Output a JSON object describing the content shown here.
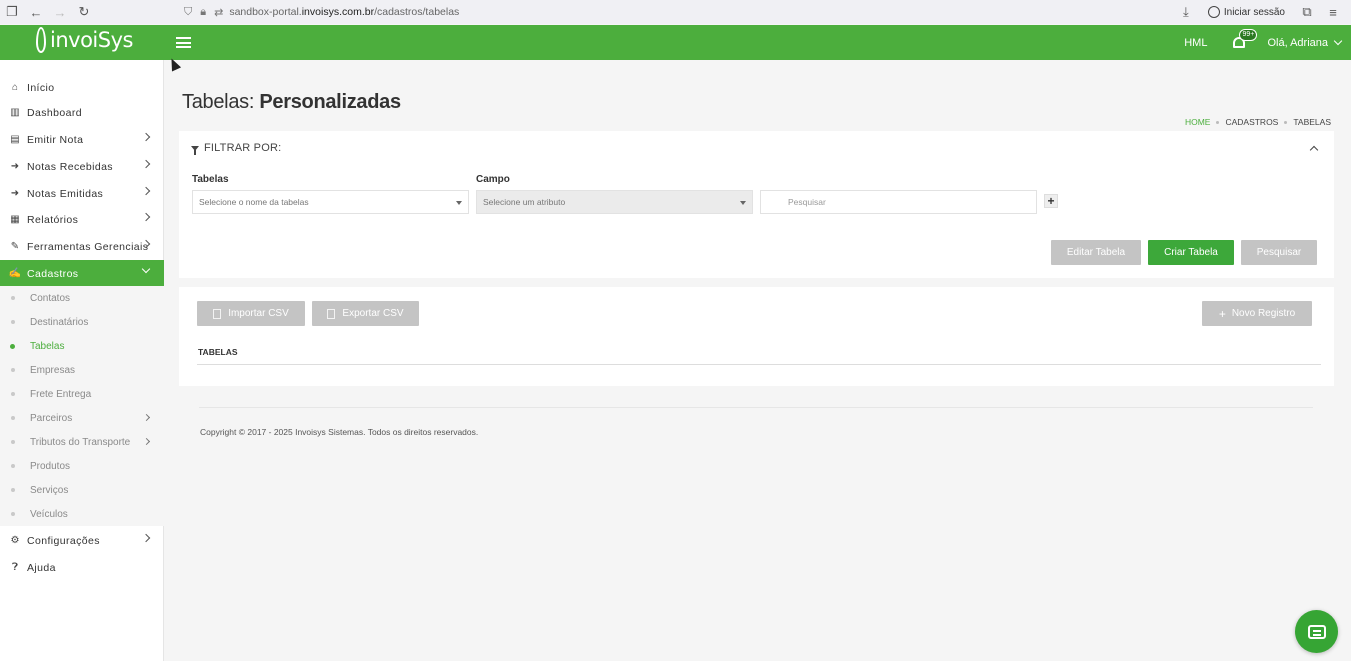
{
  "browser": {
    "url_prefix": "sandbox-portal.",
    "url_domain": "invoisys.com.br",
    "url_path": "/cadastros/tabelas",
    "login_label": "Iniciar sessão"
  },
  "header": {
    "logo_text": "invoiSys",
    "env_label": "HML",
    "notification_badge": "99+",
    "user_greeting": "Olá, Adriana"
  },
  "sidebar": {
    "items": [
      {
        "label": "Início",
        "icon": "home-icon"
      },
      {
        "label": "Dashboard",
        "icon": "bar-chart-icon"
      },
      {
        "label": "Emitir Nota",
        "icon": "document-icon"
      },
      {
        "label": "Notas Recebidas",
        "icon": "inbox-arrow-icon"
      },
      {
        "label": "Notas Emitidas",
        "icon": "outbox-arrow-icon"
      },
      {
        "label": "Relatórios",
        "icon": "report-icon"
      },
      {
        "label": "Ferramentas Gerenciais",
        "icon": "wrench-icon"
      },
      {
        "label": "Cadastros",
        "icon": "edit-icon"
      },
      {
        "label": "Configurações",
        "icon": "gear-icon"
      },
      {
        "label": "Ajuda",
        "icon": "help-icon"
      }
    ],
    "submenu": [
      {
        "label": "Contatos"
      },
      {
        "label": "Destinatários"
      },
      {
        "label": "Tabelas"
      },
      {
        "label": "Empresas"
      },
      {
        "label": "Frete Entrega"
      },
      {
        "label": "Parceiros"
      },
      {
        "label": "Tributos do Transporte"
      },
      {
        "label": "Produtos"
      },
      {
        "label": "Serviços"
      },
      {
        "label": "Veículos"
      }
    ]
  },
  "page": {
    "title_light": "Tabelas:",
    "title_strong": "Personalizadas",
    "breadcrumb": [
      "HOME",
      "CADASTROS",
      "TABELAS"
    ]
  },
  "filter": {
    "title": "FILTRAR POR:",
    "tabelas_label": "Tabelas",
    "tabelas_placeholder": "Selecione o nome da tabelas",
    "campo_label": "Campo",
    "campo_placeholder": "Selecione um atributo",
    "search_placeholder": "Pesquisar",
    "buttons": {
      "editar": "Editar Tabela",
      "criar": "Criar Tabela",
      "pesquisar": "Pesquisar"
    }
  },
  "table": {
    "importar": "Importar CSV",
    "exportar": "Exportar CSV",
    "novo": "Novo Registro",
    "header": "TABELAS"
  },
  "footer": {
    "copyright": "Copyright © 2017 - 2025 Invoisys Sistemas. Todos os direitos reservados."
  },
  "colors": {
    "brand_green": "#4cae3d",
    "button_green": "#3da83a",
    "disabled_grey": "#c4c4c4"
  }
}
